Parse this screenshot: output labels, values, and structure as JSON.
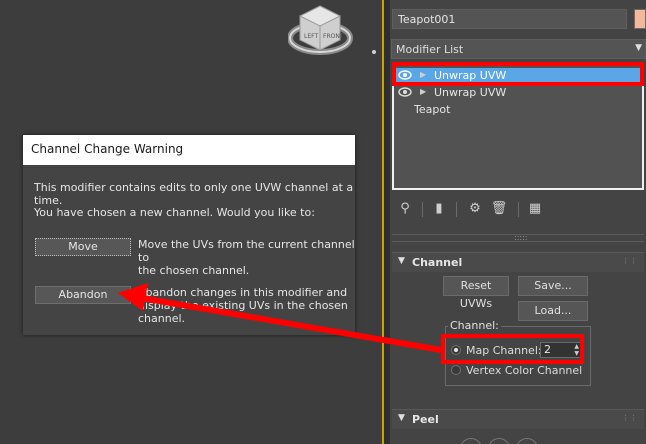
{
  "viewcube": {
    "left_label": "LEFT",
    "front_label": "FRONT"
  },
  "panel": {
    "object_name": "Teapot001",
    "modifier_list_label": "Modifier List",
    "stack": [
      {
        "label": "Unwrap UVW",
        "selected": true
      },
      {
        "label": "Unwrap UVW",
        "selected": false
      },
      {
        "label": "Teapot",
        "selected": false
      }
    ],
    "channel_rollout": {
      "title": "Channel",
      "reset_button": "Reset UVWs",
      "save_button": "Save...",
      "load_button": "Load...",
      "group_label": "Channel:",
      "map_channel_label": "Map Channel:",
      "map_channel_value": "2",
      "vertex_color_label": "Vertex Color Channel"
    },
    "peel_rollout": {
      "title": "Peel"
    }
  },
  "dialog": {
    "title": "Channel Change Warning",
    "line1": "This modifier contains edits to only one UVW channel at a time.",
    "line2": "You have chosen a new channel. Would you like to:",
    "move_button": "Move",
    "move_desc_1": "Move the UVs from the current channel to",
    "move_desc_2": "the chosen channel.",
    "abandon_button": "Abandon",
    "abandon_desc_1": "Abandon changes in this modifier and",
    "abandon_desc_2": "display the existing UVs in the chosen",
    "abandon_desc_3": "channel."
  },
  "colors": {
    "selection": "#5aa6e6",
    "annotation": "#ff0000",
    "object_color": "#f3b99a"
  }
}
